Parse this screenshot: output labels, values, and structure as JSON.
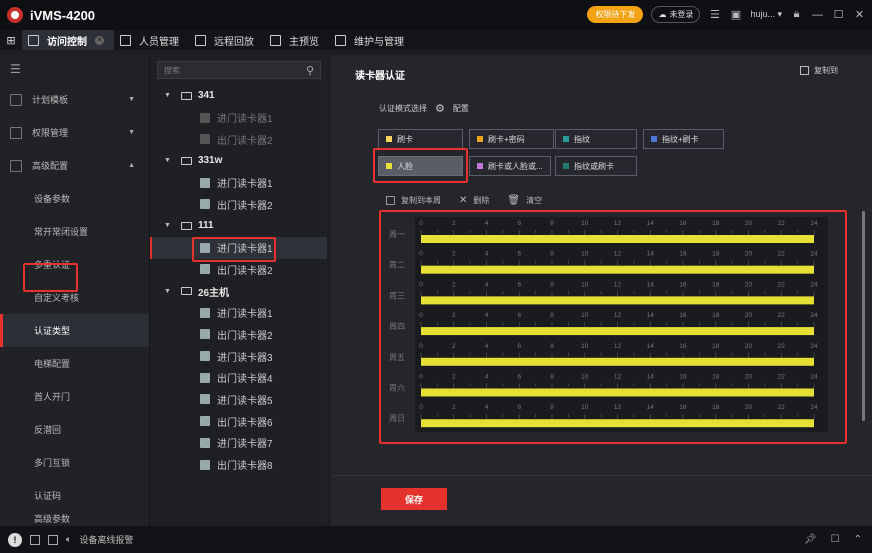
{
  "app": {
    "title": "iVMS-4200"
  },
  "titlebar": {
    "pill": "权限待下发",
    "login": "未登录",
    "user": "huju..."
  },
  "tabs": [
    {
      "label": "访问控制",
      "active": true
    },
    {
      "label": "人员管理"
    },
    {
      "label": "远程回放"
    },
    {
      "label": "主预览"
    },
    {
      "label": "维护与管理"
    }
  ],
  "sidebar": {
    "groups": [
      {
        "label": "计划模板"
      },
      {
        "label": "权限管理"
      },
      {
        "label": "高级配置"
      }
    ],
    "subitems": [
      {
        "label": "设备参数"
      },
      {
        "label": "常开常闭设置"
      },
      {
        "label": "多重认证"
      },
      {
        "label": "自定义考核"
      },
      {
        "label": "认证类型",
        "active": true
      },
      {
        "label": "电梯配置"
      },
      {
        "label": "首人开门"
      },
      {
        "label": "反潜回"
      },
      {
        "label": "多门互锁"
      },
      {
        "label": "认证码"
      },
      {
        "label": "高级参数"
      }
    ]
  },
  "tree": {
    "search_placeholder": "搜索",
    "groups": [
      {
        "label": "341",
        "children": [
          {
            "label": "进门读卡器1",
            "dim": true
          },
          {
            "label": "出门读卡器2",
            "dim": true
          }
        ]
      },
      {
        "label": "331w",
        "children": [
          {
            "label": "进门读卡器1"
          },
          {
            "label": "出门读卡器2"
          }
        ]
      },
      {
        "label": "111",
        "children": [
          {
            "label": "进门读卡器1",
            "selected": true
          },
          {
            "label": "出门读卡器2"
          }
        ]
      },
      {
        "label": "26主机",
        "children": [
          {
            "label": "进门读卡器1"
          },
          {
            "label": "出门读卡器2"
          },
          {
            "label": "进门读卡器3"
          },
          {
            "label": "出门读卡器4"
          },
          {
            "label": "进门读卡器5"
          },
          {
            "label": "出门读卡器6"
          },
          {
            "label": "进门读卡器7"
          },
          {
            "label": "出门读卡器8"
          }
        ]
      }
    ]
  },
  "main": {
    "title": "读卡器认证",
    "copy_to": "复制到",
    "mode_select_label": "认证模式选择",
    "config": "配置",
    "modes": [
      {
        "label": "刷卡",
        "color": "#f5d25a"
      },
      {
        "label": "刷卡+密码",
        "color": "#f0a020"
      },
      {
        "label": "指纹",
        "color": "#2a9a98"
      },
      {
        "label": "指纹+刷卡",
        "color": "#4a78d0"
      },
      {
        "label": "人脸",
        "color": "#e6e034",
        "active": true
      },
      {
        "label": "刷卡或人脸或...",
        "color": "#c07ad8"
      },
      {
        "label": "指纹或刷卡",
        "color": "#1f7a70"
      }
    ],
    "actions": {
      "copy_week": "复制到本周",
      "delete": "删除",
      "clear": "清空"
    },
    "schedule": {
      "days": [
        "周一",
        "周二",
        "周三",
        "周四",
        "周五",
        "周六",
        "周日"
      ],
      "hours": [
        "0",
        "2",
        "4",
        "6",
        "8",
        "10",
        "12",
        "14",
        "16",
        "18",
        "20",
        "22",
        "24"
      ],
      "segment_hours": [
        0,
        24
      ],
      "bar_color": "#e6e034"
    },
    "save": "保存"
  },
  "statusbar": {
    "alarm_text": "设备离线报警"
  }
}
